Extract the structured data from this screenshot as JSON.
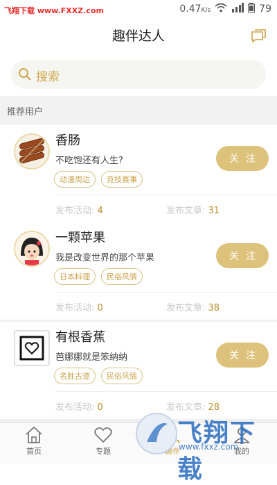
{
  "status_bar": {
    "site": "飞翔下载 www.FXXZ.com",
    "net_speed": "0.47",
    "net_unit": "K/s",
    "battery": "79"
  },
  "header": {
    "title": "趣伴达人",
    "message_icon": "chat-bubble-icon"
  },
  "search": {
    "placeholder": "搜索"
  },
  "section": {
    "label": "推荐用户"
  },
  "users": [
    {
      "name": "香肠",
      "bio": "不吃饱还有人生?",
      "tags": [
        "动漫周边",
        "竞技赛事"
      ],
      "follow": "关注",
      "activity_label": "发布活动:",
      "activity_count": "4",
      "article_label": "发布文章:",
      "article_count": "31"
    },
    {
      "name": "一颗苹果",
      "bio": "我是改变世界的那个苹果",
      "tags": [
        "日本料理",
        "民俗风情"
      ],
      "follow": "关注",
      "activity_label": "发布活动:",
      "activity_count": "0",
      "article_label": "发布文章:",
      "article_count": "38"
    },
    {
      "name": "有根香蕉",
      "bio": "芭娜娜就是笨纳纳",
      "tags": [
        "名胜古迹",
        "民俗风情"
      ],
      "follow": "关注",
      "activity_label": "发布活动:",
      "activity_count": "0",
      "article_label": "发布文章:",
      "article_count": "28"
    }
  ],
  "tabbar": {
    "home": "首页",
    "topics": "专题",
    "interest": "趣伴",
    "mine": "我的"
  },
  "watermark": {
    "text": "飞翔下载",
    "url": "www.fxxz.com"
  },
  "colors": {
    "accent": "#dcc27a",
    "accent_text": "#c9a24a",
    "stat_value": "#b9902f"
  }
}
